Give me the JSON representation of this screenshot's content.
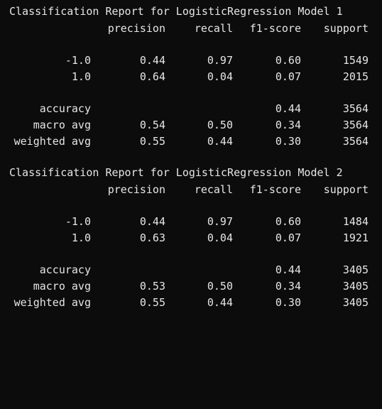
{
  "theme": {
    "background": "#0c0c0c",
    "text_color": "#e6e6e6"
  },
  "reports": [
    {
      "title": "Classification Report for LogisticRegression Model 1",
      "headers": [
        "precision",
        "recall",
        "f1-score",
        "support"
      ],
      "class_rows": [
        {
          "label": "-1.0",
          "precision": "0.44",
          "recall": "0.97",
          "f1": "0.60",
          "support": "1549"
        },
        {
          "label": "1.0",
          "precision": "0.64",
          "recall": "0.04",
          "f1": "0.07",
          "support": "2015"
        }
      ],
      "accuracy": {
        "label": "accuracy",
        "f1": "0.44",
        "support": "3564"
      },
      "macro": {
        "label": "macro avg",
        "precision": "0.54",
        "recall": "0.50",
        "f1": "0.34",
        "support": "3564"
      },
      "weighted": {
        "label": "weighted avg",
        "precision": "0.55",
        "recall": "0.44",
        "f1": "0.30",
        "support": "3564"
      }
    },
    {
      "title": "Classification Report for LogisticRegression Model 2",
      "headers": [
        "precision",
        "recall",
        "f1-score",
        "support"
      ],
      "class_rows": [
        {
          "label": "-1.0",
          "precision": "0.44",
          "recall": "0.97",
          "f1": "0.60",
          "support": "1484"
        },
        {
          "label": "1.0",
          "precision": "0.63",
          "recall": "0.04",
          "f1": "0.07",
          "support": "1921"
        }
      ],
      "accuracy": {
        "label": "accuracy",
        "f1": "0.44",
        "support": "3405"
      },
      "macro": {
        "label": "macro avg",
        "precision": "0.53",
        "recall": "0.50",
        "f1": "0.34",
        "support": "3405"
      },
      "weighted": {
        "label": "weighted avg",
        "precision": "0.55",
        "recall": "0.44",
        "f1": "0.30",
        "support": "3405"
      }
    }
  ]
}
